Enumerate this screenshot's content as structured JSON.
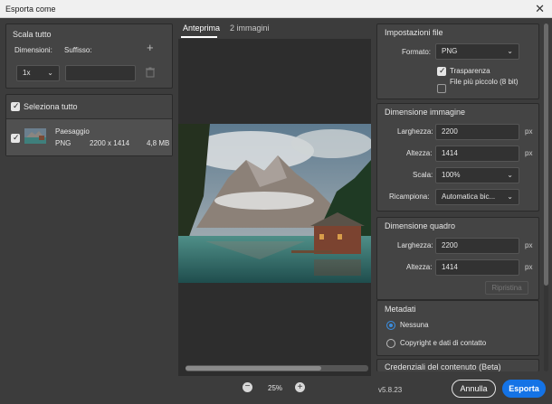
{
  "window": {
    "title": "Esporta come",
    "close_glyph": "✕"
  },
  "left": {
    "scale_all": "Scala tutto",
    "dimensions_label": "Dimensioni:",
    "suffix_label": "Suffisso:",
    "scale_value": "1x",
    "suffix_value": "",
    "add_glyph": "+",
    "select_all": "Seleziona tutto",
    "asset": {
      "name": "Paesaggio",
      "format": "PNG",
      "size": "2200 x 1414",
      "filesize": "4,8 MB"
    }
  },
  "preview": {
    "tabs": [
      {
        "label": "Anteprima"
      },
      {
        "label": "2 immagini"
      }
    ],
    "zoom": "25%",
    "zoom_out_glyph": "−",
    "zoom_in_glyph": "+"
  },
  "right": {
    "file_settings": {
      "title": "Impostazioni file",
      "format_label": "Formato:",
      "format_value": "PNG",
      "transparency_label": "Trasparenza",
      "smaller_file_label": "File più piccolo (8 bit)"
    },
    "image_size": {
      "title": "Dimensione immagine",
      "width_label": "Larghezza:",
      "width_value": "2200",
      "height_label": "Altezza:",
      "height_value": "1414",
      "scale_label": "Scala:",
      "scale_value": "100%",
      "resample_label": "Ricampiona:",
      "resample_value": "Automatica bic...",
      "unit": "px"
    },
    "canvas_size": {
      "title": "Dimensione quadro",
      "width_label": "Larghezza:",
      "width_value": "2200",
      "height_label": "Altezza:",
      "height_value": "1414",
      "unit": "px",
      "reset_label": "Ripristina"
    },
    "metadata": {
      "title": "Metadati",
      "option_none": "Nessuna",
      "option_copyright": "Copyright e dati di contatto"
    },
    "credentials": {
      "title": "Credenziali del contenuto (Beta)"
    }
  },
  "footer": {
    "version": "v5.8.23",
    "cancel_label": "Annulla",
    "export_label": "Esporta"
  },
  "colors": {
    "accent": "#1473e6",
    "radio_on": "#3b8dde",
    "background": "#3c3c3c"
  }
}
